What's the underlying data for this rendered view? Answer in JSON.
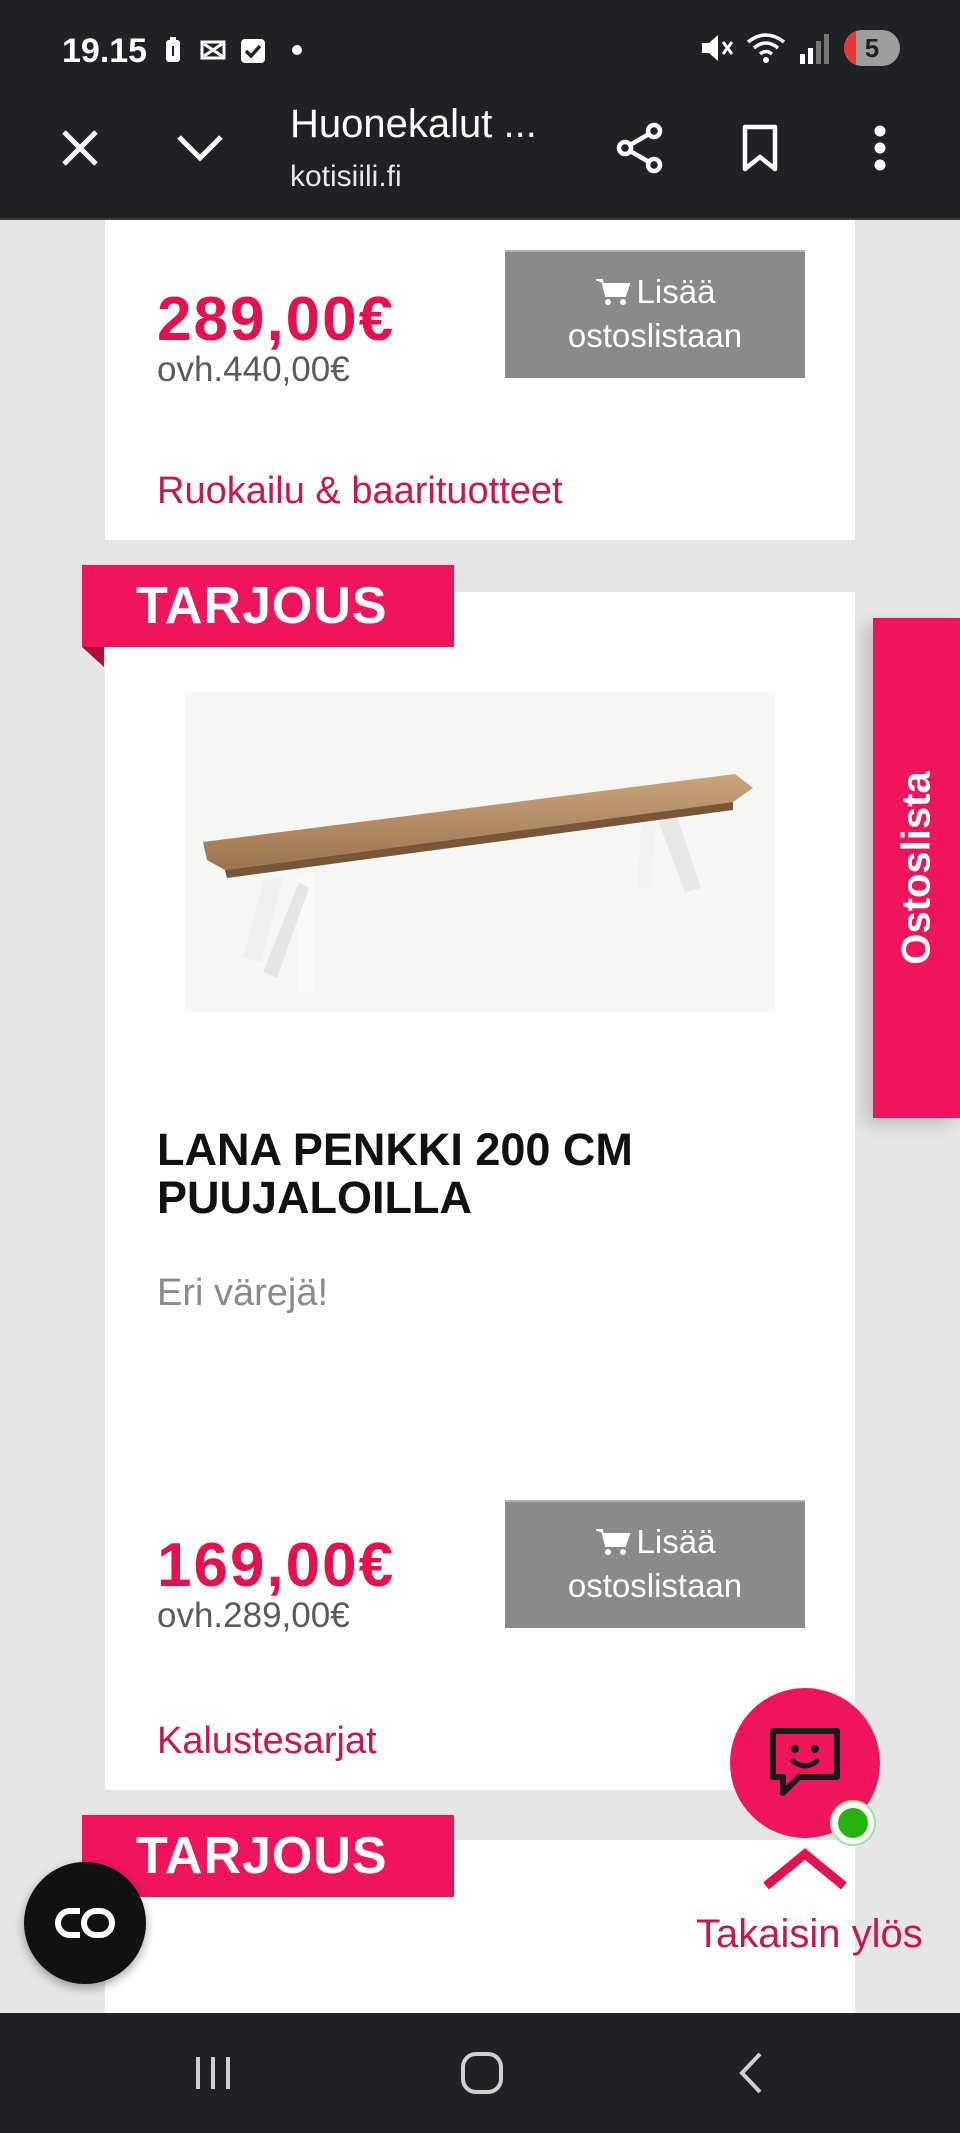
{
  "status_bar": {
    "time": "19.15",
    "left_icons": [
      "battery-saver-icon",
      "capcut-icon",
      "checkbox-icon"
    ],
    "right_icons": [
      "mute-icon",
      "wifi-icon",
      "signal-icon"
    ],
    "battery_level": "5"
  },
  "toolbar": {
    "title": "Huonekalut ...",
    "domain": "kotisiili.fi",
    "icons": [
      "close-icon",
      "chevron-down-icon",
      "share-icon",
      "bookmark-icon",
      "more-icon"
    ]
  },
  "products": [
    {
      "price": "289,00€",
      "old_price": "ovh.440,00€",
      "add_button": "Lisää ostoslistaan",
      "category": "Ruokailu & baarituotteet"
    },
    {
      "badge": "TARJOUS",
      "name": "LANA PENKKI 200 CM PUUJALOILLA",
      "description": "Eri värejä!",
      "price": "169,00€",
      "old_price": "ovh.289,00€",
      "add_button": "Lisää ostoslistaan",
      "category": "Kalustesarjat"
    },
    {
      "badge": "TARJOUS"
    }
  ],
  "floating": {
    "shopping_list_tab": "Ostoslista",
    "back_to_top": "Takaisin ylös",
    "chat_icon": "chat-smile-icon",
    "chat_status": "online"
  },
  "nav_bar": {
    "icons": [
      "recents-icon",
      "home-icon",
      "back-icon"
    ]
  },
  "colors": {
    "brand": "#f0145a",
    "price": "#e4114c",
    "button_gray": "#8a8a8a",
    "chrome": "#202124"
  }
}
